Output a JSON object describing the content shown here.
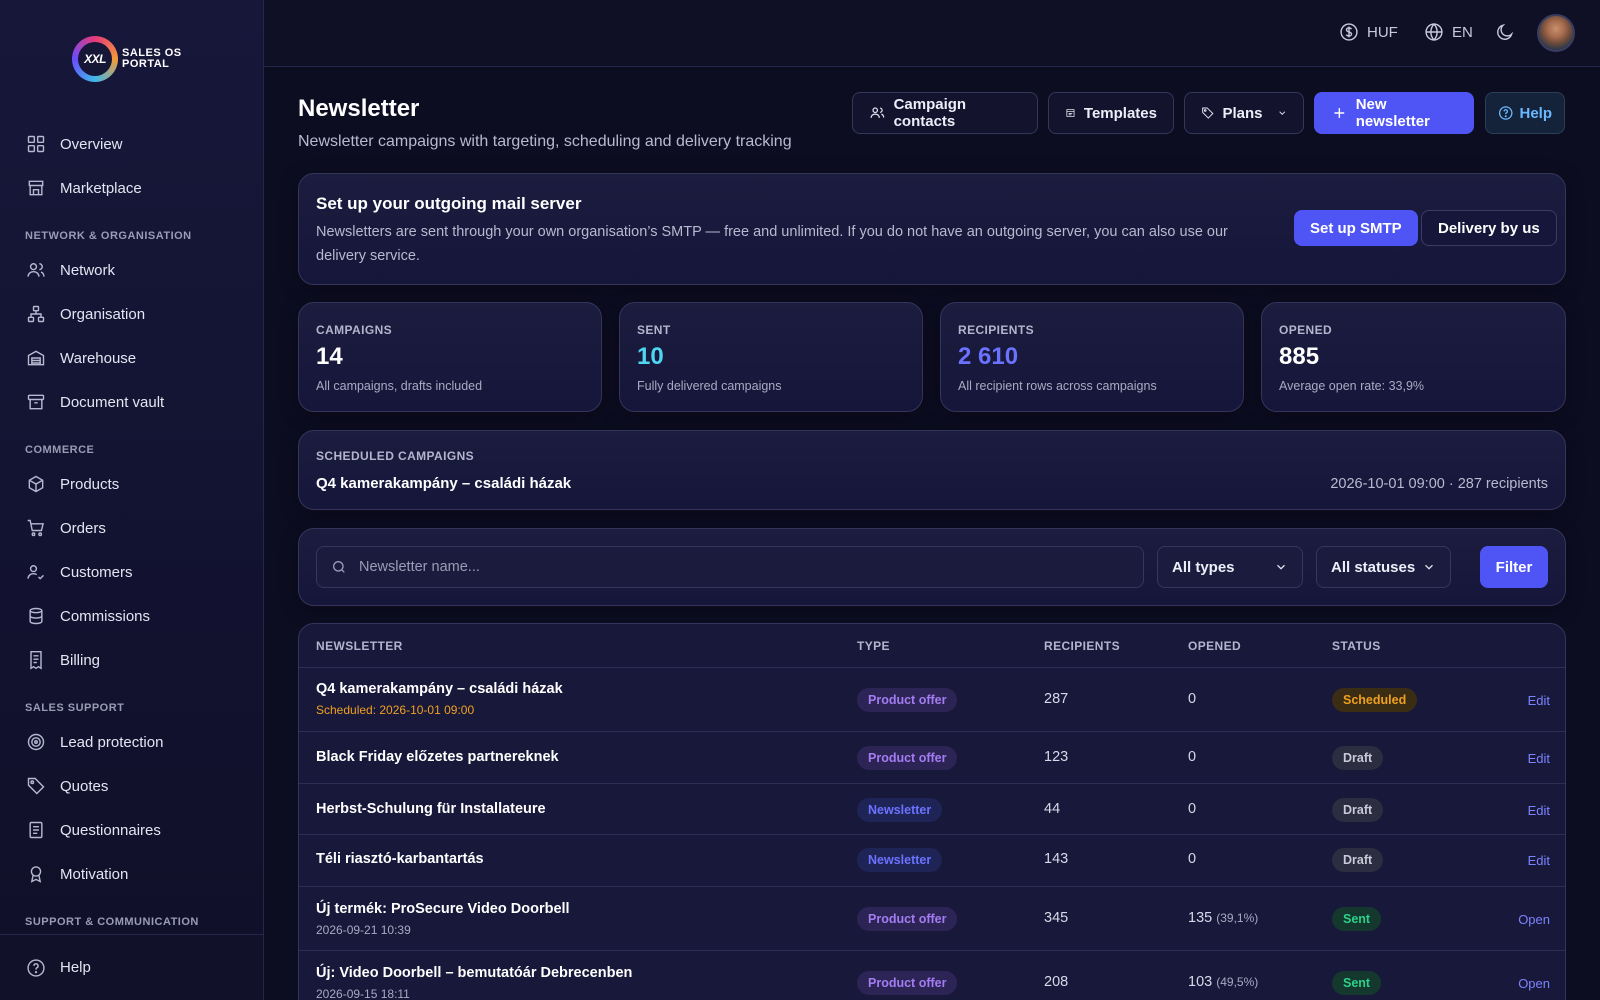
{
  "brand": {
    "logo_mark": "XXL",
    "logo_text": "SALES OS PORTAL"
  },
  "sidebar": {
    "items": [
      {
        "label": "Overview",
        "icon": "grid-icon"
      },
      {
        "label": "Marketplace",
        "icon": "store-icon"
      }
    ],
    "section_network": "NETWORK & ORGANISATION",
    "network_items": [
      {
        "label": "Network",
        "icon": "users-icon"
      },
      {
        "label": "Organisation",
        "icon": "org-chart-icon"
      },
      {
        "label": "Warehouse",
        "icon": "warehouse-icon"
      },
      {
        "label": "Document vault",
        "icon": "archive-icon"
      }
    ],
    "section_commerce": "COMMERCE",
    "commerce_items": [
      {
        "label": "Products",
        "icon": "box-icon"
      },
      {
        "label": "Orders",
        "icon": "cart-icon"
      },
      {
        "label": "Customers",
        "icon": "user-check-icon"
      },
      {
        "label": "Commissions",
        "icon": "database-icon"
      },
      {
        "label": "Billing",
        "icon": "receipt-icon"
      }
    ],
    "section_sales": "SALES SUPPORT",
    "sales_items": [
      {
        "label": "Lead protection",
        "icon": "target-icon"
      },
      {
        "label": "Quotes",
        "icon": "tag-icon"
      },
      {
        "label": "Questionnaires",
        "icon": "clipboard-icon"
      },
      {
        "label": "Motivation",
        "icon": "award-icon"
      }
    ],
    "section_support": "SUPPORT & COMMUNICATION",
    "help_label": "Help"
  },
  "topbar": {
    "currency": "HUF",
    "language": "EN"
  },
  "header": {
    "title": "Newsletter",
    "subtitle": "Newsletter campaigns with targeting, scheduling and delivery tracking",
    "campaign_contacts": "Campaign contacts",
    "templates": "Templates",
    "plans": "Plans",
    "new_newsletter": "New newsletter",
    "help": "Help"
  },
  "smtp": {
    "title": "Set up your outgoing mail server",
    "text": "Newsletters are sent through your own organisation’s SMTP — free and unlimited. If you do not have an outgoing server, you can also use our delivery service.",
    "setup_button": "Set up SMTP",
    "delivery_button": "Delivery by us"
  },
  "stats": [
    {
      "label": "CAMPAIGNS",
      "value": "14",
      "desc": "All campaigns, drafts included",
      "color": "#ffffff"
    },
    {
      "label": "SENT",
      "value": "10",
      "desc": "Fully delivered campaigns",
      "color": "#4fd6f0"
    },
    {
      "label": "RECIPIENTS",
      "value": "2 610",
      "desc": "All recipient rows across campaigns",
      "color": "#6b72ff"
    },
    {
      "label": "OPENED",
      "value": "885",
      "desc": "Average open rate: 33,9%",
      "color": "#ffffff"
    }
  ],
  "scheduled": {
    "label": "SCHEDULED CAMPAIGNS",
    "name": "Q4 kamerakampány – családi házak",
    "meta": "2026-10-01 09:00 · 287 recipients"
  },
  "filters": {
    "search_placeholder": "Newsletter name...",
    "type": "All types",
    "status": "All statuses",
    "filter_button": "Filter"
  },
  "table": {
    "columns": [
      "NEWSLETTER",
      "TYPE",
      "RECIPIENTS",
      "OPENED",
      "STATUS"
    ],
    "rows": [
      {
        "name": "Q4 kamerakampány – családi házak",
        "sub": "Scheduled: 2026-10-01 09:00",
        "type": "Product offer",
        "recipients": "287",
        "opened": "0",
        "pct": "",
        "status": "Scheduled",
        "action": "Edit"
      },
      {
        "name": "Black Friday előzetes partnereknek",
        "sub": "",
        "type": "Product offer",
        "recipients": "123",
        "opened": "0",
        "pct": "",
        "status": "Draft",
        "action": "Edit"
      },
      {
        "name": "Herbst-Schulung für Installateure",
        "sub": "",
        "type": "Newsletter",
        "recipients": "44",
        "opened": "0",
        "pct": "",
        "status": "Draft",
        "action": "Edit"
      },
      {
        "name": "Téli riasztó-karbantartás",
        "sub": "",
        "type": "Newsletter",
        "recipients": "143",
        "opened": "0",
        "pct": "",
        "status": "Draft",
        "action": "Edit"
      },
      {
        "name": "Új termék: ProSecure Video Doorbell",
        "sub": "2026-09-21 10:39",
        "type": "Product offer",
        "recipients": "345",
        "opened": "135",
        "pct": "(39,1%)",
        "status": "Sent",
        "action": "Open"
      },
      {
        "name": "Új: Video Doorbell – bemutatóár Debrecenben",
        "sub": "2026-09-15 18:11",
        "type": "Product offer",
        "recipients": "208",
        "opened": "103",
        "pct": "(49,5%)",
        "status": "Sent",
        "action": "Open"
      }
    ]
  },
  "colors": {
    "accent": "#4f55f5",
    "scheduled": "#f0a020",
    "sent": "#2bd08a",
    "draft": "#c9cad8"
  }
}
